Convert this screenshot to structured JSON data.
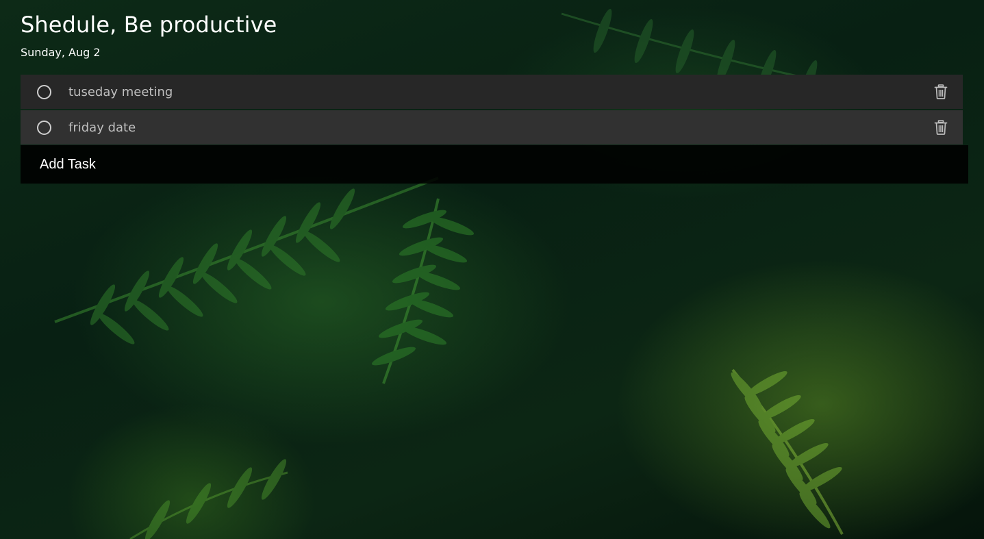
{
  "header": {
    "title": "Shedule, Be productive",
    "date": "Sunday, Aug 2"
  },
  "tasks": [
    {
      "label": "tuseday meeting",
      "completed": false,
      "check_icon": "circle-outline-icon",
      "delete_icon": "trash-icon"
    },
    {
      "label": "friday date",
      "completed": false,
      "check_icon": "circle-outline-icon",
      "delete_icon": "trash-icon"
    }
  ],
  "add_task": {
    "placeholder": "Add Task"
  },
  "colors": {
    "row_odd": "#272727",
    "row_even": "#313131",
    "add_task_bg": "#000000",
    "text_primary": "#ffffff",
    "text_task": "#bfbfbf",
    "background": "#0b1f12"
  }
}
